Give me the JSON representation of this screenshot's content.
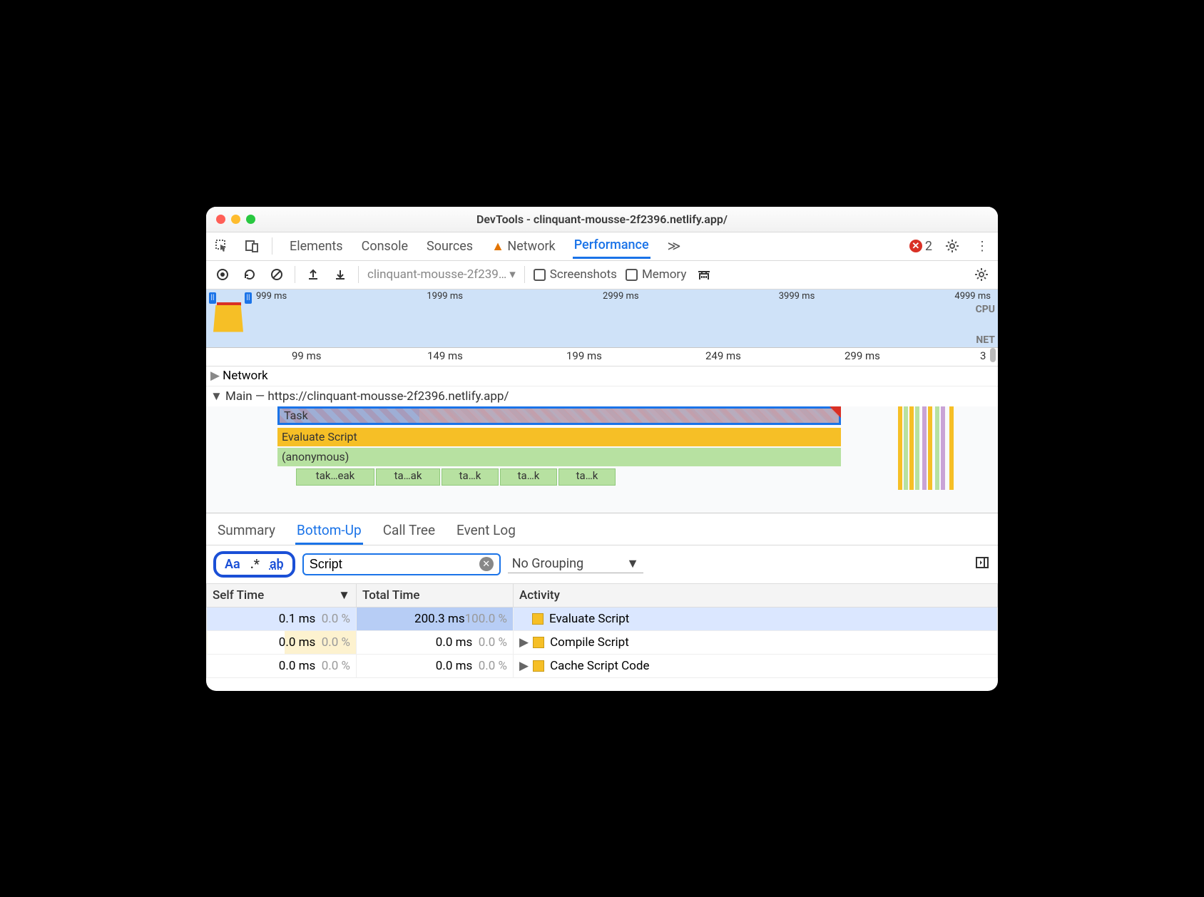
{
  "window_title": "DevTools - clinquant-mousse-2f2396.netlify.app/",
  "tabs": {
    "elements": "Elements",
    "console": "Console",
    "sources": "Sources",
    "network": "Network",
    "performance": "Performance",
    "more": "≫"
  },
  "error_count": "2",
  "perf_toolbar": {
    "profile_name": "clinquant-mousse-2f239…",
    "screenshots": "Screenshots",
    "memory": "Memory"
  },
  "overview": {
    "ticks": [
      "999 ms",
      "1999 ms",
      "2999 ms",
      "3999 ms",
      "4999 ms"
    ],
    "cpu": "CPU",
    "net": "NET"
  },
  "ruler_ticks": [
    "99 ms",
    "149 ms",
    "199 ms",
    "249 ms",
    "299 ms",
    "3"
  ],
  "lanes": {
    "network": "Network",
    "main": "Main — https://clinquant-mousse-2f2396.netlify.app/"
  },
  "flame": {
    "task": "Task",
    "evaluate": "Evaluate Script",
    "anonymous": "(anonymous)",
    "leaves": [
      "tak…eak",
      "ta…ak",
      "ta…k",
      "ta…k",
      "ta…k"
    ]
  },
  "detail_tabs": {
    "summary": "Summary",
    "bottomup": "Bottom-Up",
    "calltree": "Call Tree",
    "eventlog": "Event Log"
  },
  "filter": {
    "aa": "Aa",
    "regex": ".*",
    "word": "ab",
    "query": "Script",
    "grouping": "No Grouping"
  },
  "table": {
    "headers": {
      "self": "Self Time",
      "total": "Total Time",
      "activity": "Activity"
    },
    "rows": [
      {
        "self_ms": "0.1 ms",
        "self_pct": "0.0 %",
        "total_ms": "200.3 ms",
        "total_pct": "100.0 %",
        "activity": "Evaluate Script",
        "expandable": false,
        "selected": true
      },
      {
        "self_ms": "0.0 ms",
        "self_pct": "0.0 %",
        "total_ms": "0.0 ms",
        "total_pct": "0.0 %",
        "activity": "Compile Script",
        "expandable": true,
        "selected": false
      },
      {
        "self_ms": "0.0 ms",
        "self_pct": "0.0 %",
        "total_ms": "0.0 ms",
        "total_pct": "0.0 %",
        "activity": "Cache Script Code",
        "expandable": true,
        "selected": false
      }
    ]
  }
}
